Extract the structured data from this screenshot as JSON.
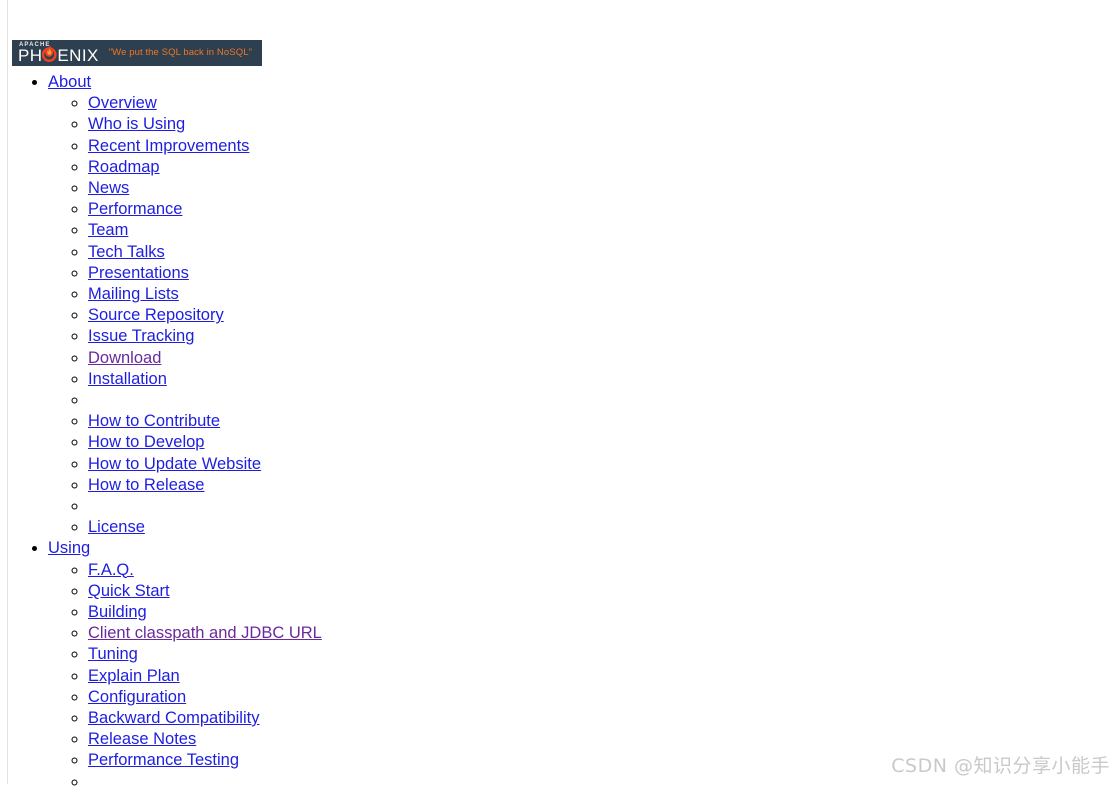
{
  "page": {
    "background_color": "#ffffff",
    "frame_line_color": "#e3e3e3"
  },
  "logo": {
    "apache_text": "APACHE",
    "wordmark_part1": "PH",
    "wordmark_flame": "phoenix-flame-icon",
    "wordmark_part2": "ENIX",
    "tagline": "\"We put the SQL back in NoSQL\"",
    "banner_color": "#2e3f50",
    "tagline_color": "#ef7622",
    "flame_color": "#ef4123"
  },
  "colors": {
    "link": "#1e1ee0",
    "link_visited": "#6a2a9b",
    "watermark": "#c9c9c9"
  },
  "nav": {
    "sections": [
      {
        "label": "About",
        "visited": false,
        "items": [
          {
            "label": "Overview",
            "visited": false
          },
          {
            "label": "Who is Using",
            "visited": false
          },
          {
            "label": "Recent Improvements",
            "visited": false
          },
          {
            "label": "Roadmap",
            "visited": false
          },
          {
            "label": "News",
            "visited": false
          },
          {
            "label": "Performance",
            "visited": false
          },
          {
            "label": "Team",
            "visited": false
          },
          {
            "label": "Tech Talks",
            "visited": false
          },
          {
            "label": "Presentations",
            "visited": false
          },
          {
            "label": "Mailing Lists",
            "visited": false
          },
          {
            "label": "Source Repository",
            "visited": false
          },
          {
            "label": "Issue Tracking",
            "visited": false
          },
          {
            "label": "Download",
            "visited": true
          },
          {
            "label": "Installation",
            "visited": false
          },
          {
            "label": "",
            "separator": true
          },
          {
            "label": "How to Contribute",
            "visited": false
          },
          {
            "label": "How to Develop",
            "visited": false
          },
          {
            "label": "How to Update Website",
            "visited": false
          },
          {
            "label": "How to Release",
            "visited": false
          },
          {
            "label": "",
            "separator": true
          },
          {
            "label": "License",
            "visited": false
          }
        ]
      },
      {
        "label": "Using",
        "visited": false,
        "items": [
          {
            "label": "F.A.Q.",
            "visited": false
          },
          {
            "label": "Quick Start",
            "visited": false
          },
          {
            "label": "Building",
            "visited": false
          },
          {
            "label": "Client classpath and JDBC URL",
            "visited": true
          },
          {
            "label": "Tuning",
            "visited": false
          },
          {
            "label": "Explain Plan",
            "visited": false
          },
          {
            "label": "Configuration",
            "visited": false
          },
          {
            "label": "Backward Compatibility",
            "visited": false
          },
          {
            "label": "Release Notes",
            "visited": false
          },
          {
            "label": "Performance Testing",
            "visited": false
          },
          {
            "label": "",
            "separator": true
          }
        ]
      }
    ]
  },
  "watermark": {
    "text": "CSDN @知识分享小能手"
  }
}
